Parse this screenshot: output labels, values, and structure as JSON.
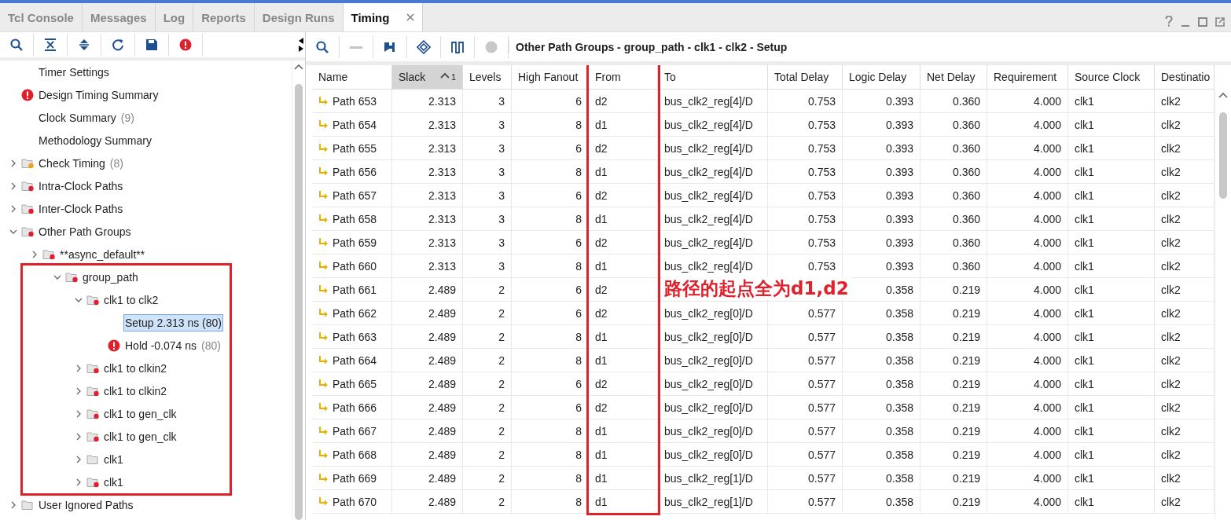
{
  "tabs": [
    {
      "label": "Tcl Console",
      "selected": false
    },
    {
      "label": "Messages",
      "selected": false
    },
    {
      "label": "Log",
      "selected": false
    },
    {
      "label": "Reports",
      "selected": false
    },
    {
      "label": "Design Runs",
      "selected": false
    },
    {
      "label": "Timing",
      "selected": true,
      "closable": true
    }
  ],
  "tree": [
    {
      "label": "Timer Settings",
      "kind": "plain"
    },
    {
      "label": "Design Timing Summary",
      "kind": "error"
    },
    {
      "label": "Clock Summary",
      "count": "(9)",
      "kind": "plain"
    },
    {
      "label": "Methodology Summary",
      "kind": "plain"
    },
    {
      "label": "Check Timing",
      "count": "(8)",
      "kind": "folder",
      "color": "#f0a020",
      "expanded": false
    },
    {
      "label": "Intra-Clock Paths",
      "kind": "folder",
      "color": "#e02030",
      "expanded": false
    },
    {
      "label": "Inter-Clock Paths",
      "kind": "folder",
      "color": "#e02030",
      "expanded": false
    },
    {
      "label": "Other Path Groups",
      "kind": "folder",
      "color": "#e02030",
      "expanded": true,
      "children": [
        {
          "label": "**async_default**",
          "kind": "folder",
          "color": "#e02030",
          "expanded": false
        },
        {
          "label": "group_path",
          "kind": "folder",
          "color": "#e02030",
          "expanded": true,
          "annotated": true,
          "children": [
            {
              "label": "clk1 to clk2",
              "kind": "folder",
              "color": "#e02030",
              "expanded": true,
              "children": [
                {
                  "label": "Setup 2.313 ns (80)",
                  "kind": "plain",
                  "selected": true
                },
                {
                  "label": "Hold -0.074 ns",
                  "count": "(80)",
                  "kind": "error",
                  "selected": false
                }
              ]
            },
            {
              "label": "clk1 to clkin2",
              "kind": "folder",
              "color": "#e02030",
              "expanded": false
            },
            {
              "label": "clk1 to clkin2",
              "kind": "folder",
              "color": "#e02030",
              "expanded": false
            },
            {
              "label": "clk1 to gen_clk",
              "kind": "folder",
              "color": "#e02030",
              "expanded": false
            },
            {
              "label": "clk1 to gen_clk",
              "kind": "folder",
              "color": "#e02030",
              "expanded": false
            },
            {
              "label": "clk1",
              "kind": "folder",
              "expanded": false
            },
            {
              "label": "clk1",
              "kind": "folder",
              "color": "#e02030",
              "expanded": false
            }
          ]
        }
      ]
    },
    {
      "label": "User Ignored Paths",
      "kind": "folder",
      "expanded": false
    }
  ],
  "report_title": "Other Path Groups - group_path - clk1 - clk2 - Setup",
  "table": {
    "columns": [
      {
        "label": "Name"
      },
      {
        "label": "Slack",
        "sorted": true,
        "sort_index": "1"
      },
      {
        "label": "Levels"
      },
      {
        "label": "High Fanout"
      },
      {
        "label": "From",
        "annotated": true
      },
      {
        "label": "To"
      },
      {
        "label": "Total Delay"
      },
      {
        "label": "Logic Delay"
      },
      {
        "label": "Net Delay"
      },
      {
        "label": "Requirement"
      },
      {
        "label": "Source Clock"
      },
      {
        "label": "Destinatio"
      }
    ],
    "rows": [
      [
        "Path 653",
        "2.313",
        "3",
        "6",
        "d2",
        "bus_clk2_reg[4]/D",
        "0.753",
        "0.393",
        "0.360",
        "4.000",
        "clk1",
        "clk2"
      ],
      [
        "Path 654",
        "2.313",
        "3",
        "8",
        "d1",
        "bus_clk2_reg[4]/D",
        "0.753",
        "0.393",
        "0.360",
        "4.000",
        "clk1",
        "clk2"
      ],
      [
        "Path 655",
        "2.313",
        "3",
        "6",
        "d2",
        "bus_clk2_reg[4]/D",
        "0.753",
        "0.393",
        "0.360",
        "4.000",
        "clk1",
        "clk2"
      ],
      [
        "Path 656",
        "2.313",
        "3",
        "8",
        "d1",
        "bus_clk2_reg[4]/D",
        "0.753",
        "0.393",
        "0.360",
        "4.000",
        "clk1",
        "clk2"
      ],
      [
        "Path 657",
        "2.313",
        "3",
        "6",
        "d2",
        "bus_clk2_reg[4]/D",
        "0.753",
        "0.393",
        "0.360",
        "4.000",
        "clk1",
        "clk2"
      ],
      [
        "Path 658",
        "2.313",
        "3",
        "8",
        "d1",
        "bus_clk2_reg[4]/D",
        "0.753",
        "0.393",
        "0.360",
        "4.000",
        "clk1",
        "clk2"
      ],
      [
        "Path 659",
        "2.313",
        "3",
        "6",
        "d2",
        "bus_clk2_reg[4]/D",
        "0.753",
        "0.393",
        "0.360",
        "4.000",
        "clk1",
        "clk2"
      ],
      [
        "Path 660",
        "2.313",
        "3",
        "8",
        "d1",
        "bus_clk2_reg[4]/D",
        "0.753",
        "0.393",
        "0.360",
        "4.000",
        "clk1",
        "clk2"
      ],
      [
        "Path 661",
        "2.489",
        "2",
        "6",
        "d2",
        null,
        null,
        "0.358",
        "0.219",
        "4.000",
        "clk1",
        "clk2"
      ],
      [
        "Path 662",
        "2.489",
        "2",
        "6",
        "d2",
        "bus_clk2_reg[0]/D",
        "0.577",
        "0.358",
        "0.219",
        "4.000",
        "clk1",
        "clk2"
      ],
      [
        "Path 663",
        "2.489",
        "2",
        "8",
        "d1",
        "bus_clk2_reg[0]/D",
        "0.577",
        "0.358",
        "0.219",
        "4.000",
        "clk1",
        "clk2"
      ],
      [
        "Path 664",
        "2.489",
        "2",
        "8",
        "d1",
        "bus_clk2_reg[0]/D",
        "0.577",
        "0.358",
        "0.219",
        "4.000",
        "clk1",
        "clk2"
      ],
      [
        "Path 665",
        "2.489",
        "2",
        "6",
        "d2",
        "bus_clk2_reg[0]/D",
        "0.577",
        "0.358",
        "0.219",
        "4.000",
        "clk1",
        "clk2"
      ],
      [
        "Path 666",
        "2.489",
        "2",
        "6",
        "d2",
        "bus_clk2_reg[0]/D",
        "0.577",
        "0.358",
        "0.219",
        "4.000",
        "clk1",
        "clk2"
      ],
      [
        "Path 667",
        "2.489",
        "2",
        "8",
        "d1",
        "bus_clk2_reg[0]/D",
        "0.577",
        "0.358",
        "0.219",
        "4.000",
        "clk1",
        "clk2"
      ],
      [
        "Path 668",
        "2.489",
        "2",
        "8",
        "d1",
        "bus_clk2_reg[0]/D",
        "0.577",
        "0.358",
        "0.219",
        "4.000",
        "clk1",
        "clk2"
      ],
      [
        "Path 669",
        "2.489",
        "2",
        "8",
        "d1",
        "bus_clk2_reg[1]/D",
        "0.577",
        "0.358",
        "0.219",
        "4.000",
        "clk1",
        "clk2"
      ],
      [
        "Path 670",
        "2.489",
        "2",
        "8",
        "d1",
        "bus_clk2_reg[1]/D",
        "0.577",
        "0.358",
        "0.219",
        "4.000",
        "clk1",
        "clk2"
      ]
    ]
  },
  "annotation": "路径的起点全为d1,d2"
}
